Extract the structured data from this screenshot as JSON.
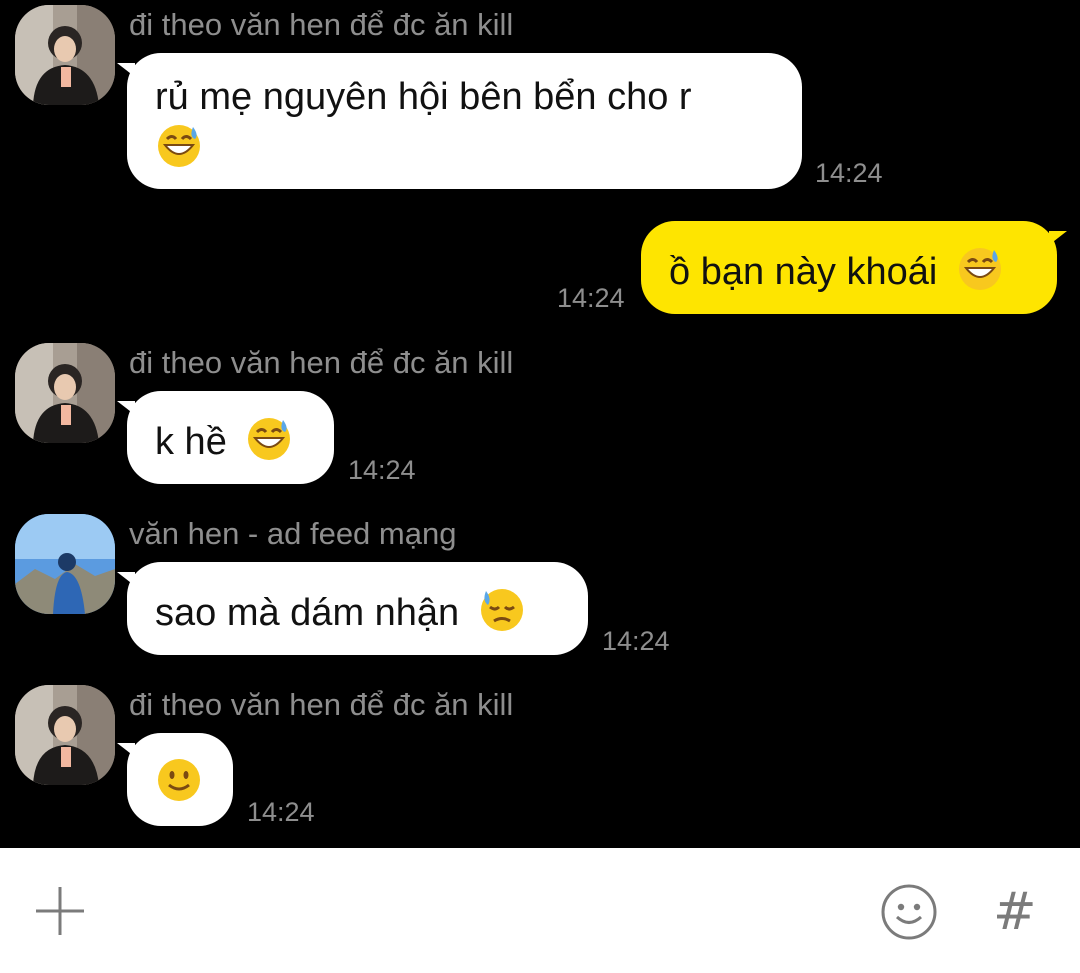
{
  "messages": [
    {
      "sender": "đi theo văn hen để đc ăn kill",
      "lines": [
        "rủ mẹ nguyên hội bên bển cho r",
        ""
      ],
      "time": "14:24"
    },
    {
      "sender": "",
      "lines": [
        "ồ bạn này khoái"
      ],
      "time": "14:24"
    },
    {
      "sender": "đi theo văn hen để đc ăn kill",
      "lines": [
        "k hề"
      ],
      "time": "14:24"
    },
    {
      "sender": "văn hen - ad feed mạng",
      "lines": [
        "sao mà dám nhận"
      ],
      "time": "14:24"
    },
    {
      "sender": "đi theo văn hen để đc ăn kill",
      "lines": [
        ""
      ],
      "time": "14:24"
    }
  ],
  "icons": {
    "plus": "plus-icon",
    "emoji": "smiley-icon",
    "hashtag": "#"
  },
  "colors": {
    "background": "#000000",
    "incoming_bubble": "#ffffff",
    "outgoing_bubble": "#fee500",
    "meta_text": "#8e8e8e"
  }
}
